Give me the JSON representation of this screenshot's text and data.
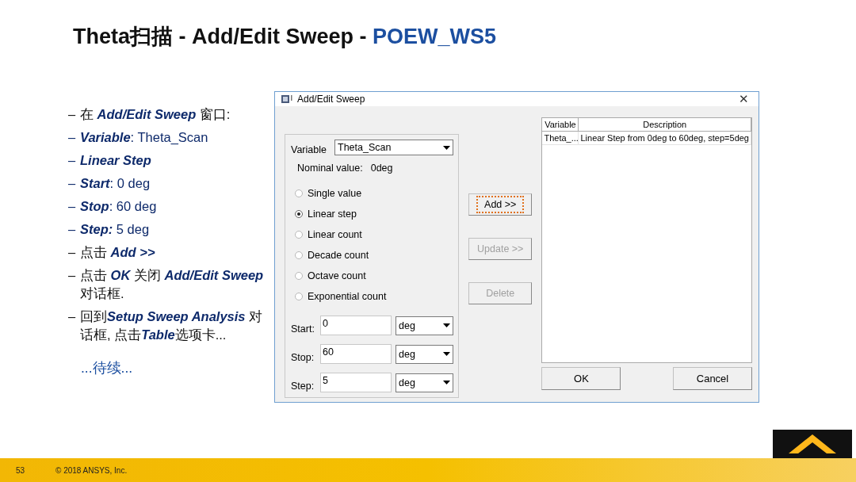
{
  "slide": {
    "title": "Theta扫描 - Add/Edit Sweep - ",
    "title_accent": "POEW_WS5",
    "bullets": [
      {
        "kind": "plain",
        "parts": [
          {
            "text": "在 ",
            "italic": false
          },
          {
            "text": "Add/Edit Sweep",
            "italic": true
          },
          {
            "text": " 窗口:",
            "italic": false
          }
        ]
      },
      {
        "kind": "highlight",
        "parts": [
          {
            "text": "Variable",
            "italic": true
          },
          {
            "text": ":  Theta_Scan",
            "italic": false
          }
        ]
      },
      {
        "kind": "highlight",
        "parts": [
          {
            "text": "Linear Step",
            "italic": true
          }
        ]
      },
      {
        "kind": "highlight",
        "parts": [
          {
            "text": "Start",
            "italic": true
          },
          {
            "text": ": 0 deg",
            "italic": false
          }
        ]
      },
      {
        "kind": "highlight",
        "parts": [
          {
            "text": "Stop",
            "italic": true
          },
          {
            "text": ": 60 deg",
            "italic": false
          }
        ]
      },
      {
        "kind": "highlight",
        "parts": [
          {
            "text": "Step:",
            "italic": true
          },
          {
            "text": " 5 deg",
            "italic": false
          }
        ]
      },
      {
        "kind": "plain",
        "parts": [
          {
            "text": "点击 ",
            "italic": false
          },
          {
            "text": "Add >>",
            "italic": true
          }
        ]
      },
      {
        "kind": "plain",
        "parts": [
          {
            "text": "点击 ",
            "italic": false
          },
          {
            "text": "OK",
            "italic": true
          },
          {
            "text": " 关闭 ",
            "italic": false
          },
          {
            "text": "Add/Edit Sweep",
            "italic": true
          },
          {
            "text": " 对话框.",
            "italic": false
          }
        ]
      },
      {
        "kind": "plain",
        "parts": [
          {
            "text": "回到",
            "italic": false
          },
          {
            "text": "Setup Sweep Analysis",
            "italic": true
          },
          {
            "text": " 对话框, 点击",
            "italic": false
          },
          {
            "text": "Table",
            "italic": true
          },
          {
            "text": "选项卡...",
            "italic": false
          }
        ]
      }
    ],
    "bullet_mark": "–",
    "continued": "...待续...",
    "page_number": "53",
    "copyright": "© 2018 ANSYS, Inc."
  },
  "dialog": {
    "title": "Add/Edit Sweep",
    "close": "✕",
    "variable": {
      "label": "Variable",
      "value": "Theta_Scan"
    },
    "nominal": {
      "label": "Nominal value:",
      "value": "0deg"
    },
    "options": [
      {
        "label": "Single value",
        "selected": false
      },
      {
        "label": "Linear step",
        "selected": true
      },
      {
        "label": "Linear count",
        "selected": false
      },
      {
        "label": "Decade count",
        "selected": false
      },
      {
        "label": "Octave count",
        "selected": false
      },
      {
        "label": "Exponential count",
        "selected": false
      }
    ],
    "ranges": [
      {
        "label": "Start:",
        "value": "0",
        "unit": "deg"
      },
      {
        "label": "Stop:",
        "value": "60",
        "unit": "deg"
      },
      {
        "label": "Step:",
        "value": "5",
        "unit": "deg"
      }
    ],
    "actions": [
      {
        "label": "Add  >>",
        "focused": true,
        "disabled": false
      },
      {
        "label": "Update >>",
        "focused": false,
        "disabled": true
      },
      {
        "label": "Delete",
        "focused": false,
        "disabled": true
      }
    ],
    "table": {
      "columns": [
        "Variable",
        "Description"
      ],
      "rows": [
        [
          "Theta_...",
          "Linear Step from 0deg to 60deg, step=5deg"
        ]
      ]
    },
    "buttons": [
      "OK",
      "Cancel"
    ]
  }
}
